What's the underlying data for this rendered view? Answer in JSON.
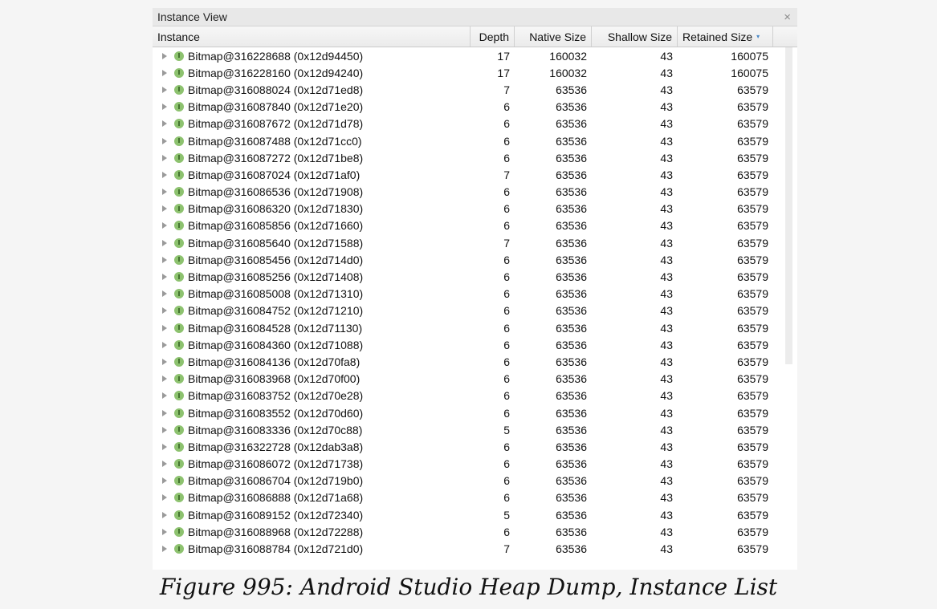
{
  "window": {
    "title": "Instance View",
    "close_glyph": "×"
  },
  "columns": {
    "instance": "Instance",
    "depth": "Depth",
    "native_size": "Native Size",
    "shallow_size": "Shallow Size",
    "retained_size": "Retained Size",
    "sort_indicator": "▾"
  },
  "badge_letter": "I",
  "rows": [
    {
      "instance": "Bitmap@316228688 (0x12d94450)",
      "depth": "17",
      "native": "160032",
      "shallow": "43",
      "retained": "160075"
    },
    {
      "instance": "Bitmap@316228160 (0x12d94240)",
      "depth": "17",
      "native": "160032",
      "shallow": "43",
      "retained": "160075"
    },
    {
      "instance": "Bitmap@316088024 (0x12d71ed8)",
      "depth": "7",
      "native": "63536",
      "shallow": "43",
      "retained": "63579"
    },
    {
      "instance": "Bitmap@316087840 (0x12d71e20)",
      "depth": "6",
      "native": "63536",
      "shallow": "43",
      "retained": "63579"
    },
    {
      "instance": "Bitmap@316087672 (0x12d71d78)",
      "depth": "6",
      "native": "63536",
      "shallow": "43",
      "retained": "63579"
    },
    {
      "instance": "Bitmap@316087488 (0x12d71cc0)",
      "depth": "6",
      "native": "63536",
      "shallow": "43",
      "retained": "63579"
    },
    {
      "instance": "Bitmap@316087272 (0x12d71be8)",
      "depth": "6",
      "native": "63536",
      "shallow": "43",
      "retained": "63579"
    },
    {
      "instance": "Bitmap@316087024 (0x12d71af0)",
      "depth": "7",
      "native": "63536",
      "shallow": "43",
      "retained": "63579"
    },
    {
      "instance": "Bitmap@316086536 (0x12d71908)",
      "depth": "6",
      "native": "63536",
      "shallow": "43",
      "retained": "63579"
    },
    {
      "instance": "Bitmap@316086320 (0x12d71830)",
      "depth": "6",
      "native": "63536",
      "shallow": "43",
      "retained": "63579"
    },
    {
      "instance": "Bitmap@316085856 (0x12d71660)",
      "depth": "6",
      "native": "63536",
      "shallow": "43",
      "retained": "63579"
    },
    {
      "instance": "Bitmap@316085640 (0x12d71588)",
      "depth": "7",
      "native": "63536",
      "shallow": "43",
      "retained": "63579"
    },
    {
      "instance": "Bitmap@316085456 (0x12d714d0)",
      "depth": "6",
      "native": "63536",
      "shallow": "43",
      "retained": "63579"
    },
    {
      "instance": "Bitmap@316085256 (0x12d71408)",
      "depth": "6",
      "native": "63536",
      "shallow": "43",
      "retained": "63579"
    },
    {
      "instance": "Bitmap@316085008 (0x12d71310)",
      "depth": "6",
      "native": "63536",
      "shallow": "43",
      "retained": "63579"
    },
    {
      "instance": "Bitmap@316084752 (0x12d71210)",
      "depth": "6",
      "native": "63536",
      "shallow": "43",
      "retained": "63579"
    },
    {
      "instance": "Bitmap@316084528 (0x12d71130)",
      "depth": "6",
      "native": "63536",
      "shallow": "43",
      "retained": "63579"
    },
    {
      "instance": "Bitmap@316084360 (0x12d71088)",
      "depth": "6",
      "native": "63536",
      "shallow": "43",
      "retained": "63579"
    },
    {
      "instance": "Bitmap@316084136 (0x12d70fa8)",
      "depth": "6",
      "native": "63536",
      "shallow": "43",
      "retained": "63579"
    },
    {
      "instance": "Bitmap@316083968 (0x12d70f00)",
      "depth": "6",
      "native": "63536",
      "shallow": "43",
      "retained": "63579"
    },
    {
      "instance": "Bitmap@316083752 (0x12d70e28)",
      "depth": "6",
      "native": "63536",
      "shallow": "43",
      "retained": "63579"
    },
    {
      "instance": "Bitmap@316083552 (0x12d70d60)",
      "depth": "6",
      "native": "63536",
      "shallow": "43",
      "retained": "63579"
    },
    {
      "instance": "Bitmap@316083336 (0x12d70c88)",
      "depth": "5",
      "native": "63536",
      "shallow": "43",
      "retained": "63579"
    },
    {
      "instance": "Bitmap@316322728 (0x12dab3a8)",
      "depth": "6",
      "native": "63536",
      "shallow": "43",
      "retained": "63579"
    },
    {
      "instance": "Bitmap@316086072 (0x12d71738)",
      "depth": "6",
      "native": "63536",
      "shallow": "43",
      "retained": "63579"
    },
    {
      "instance": "Bitmap@316086704 (0x12d719b0)",
      "depth": "6",
      "native": "63536",
      "shallow": "43",
      "retained": "63579"
    },
    {
      "instance": "Bitmap@316086888 (0x12d71a68)",
      "depth": "6",
      "native": "63536",
      "shallow": "43",
      "retained": "63579"
    },
    {
      "instance": "Bitmap@316089152 (0x12d72340)",
      "depth": "5",
      "native": "63536",
      "shallow": "43",
      "retained": "63579"
    },
    {
      "instance": "Bitmap@316088968 (0x12d72288)",
      "depth": "6",
      "native": "63536",
      "shallow": "43",
      "retained": "63579"
    },
    {
      "instance": "Bitmap@316088784 (0x12d721d0)",
      "depth": "7",
      "native": "63536",
      "shallow": "43",
      "retained": "63579"
    }
  ],
  "caption": "Figure 995: Android Studio Heap Dump, Instance List"
}
